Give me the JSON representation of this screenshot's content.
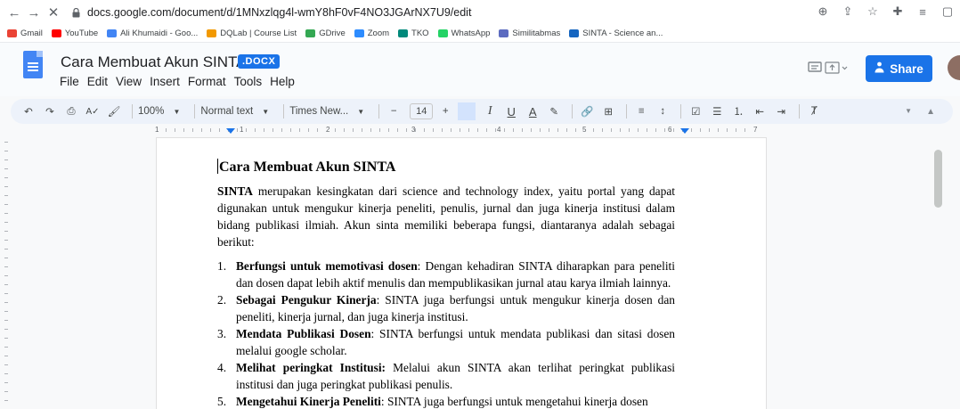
{
  "browser": {
    "url": "docs.google.com/document/d/1MNxzlqg4l-wmY8hF0vF4NO3JGArNX7U9/edit"
  },
  "bookmarks": [
    {
      "label": "Gmail",
      "color": "#ea4335"
    },
    {
      "label": "YouTube",
      "color": "#ff0000"
    },
    {
      "label": "Ali Khumaidi - Goo...",
      "color": "#4285f4"
    },
    {
      "label": "DQLab | Course List",
      "color": "#f29900"
    },
    {
      "label": "GDrive",
      "color": "#34a853"
    },
    {
      "label": "Zoom",
      "color": "#2d8cff"
    },
    {
      "label": "TKO",
      "color": "#00897b"
    },
    {
      "label": "WhatsApp",
      "color": "#25d366"
    },
    {
      "label": "Similitabmas",
      "color": "#5c6bc0"
    },
    {
      "label": "SINTA - Science an...",
      "color": "#1565c0"
    }
  ],
  "header": {
    "title": "Cara Membuat Akun SINTA",
    "badge": ".DOCX",
    "share_label": "Share"
  },
  "menu": [
    "File",
    "Edit",
    "View",
    "Insert",
    "Format",
    "Tools",
    "Help"
  ],
  "toolbar": {
    "zoom": "100%",
    "style": "Normal text",
    "font": "Times New...",
    "size": "14"
  },
  "ruler": [
    "1",
    "1",
    "2",
    "3",
    "4",
    "5",
    "6",
    "7"
  ],
  "document": {
    "heading": "Cara Membuat Akun SINTA",
    "intro_bold": "SINTA",
    "intro_rest": " merupakan kesingkatan dari science and technology index, yaitu portal yang dapat digunakan untuk mengukur kinerja peneliti, penulis, jurnal dan juga kinerja institusi dalam bidang publikasi ilmiah. Akun sinta memiliki beberapa fungsi, diantaranya adalah sebagai berikut:",
    "items": [
      {
        "num": "1.",
        "bold": "Berfungsi untuk memotivasi dosen",
        "rest": ": Dengan kehadiran SINTA diharapkan para peneliti dan dosen dapat lebih aktif menulis dan mempublikasikan jurnal atau karya ilmiah lainnya."
      },
      {
        "num": "2.",
        "bold": "Sebagai Pengukur Kinerja",
        "rest": ": SINTA juga berfungsi untuk mengukur kinerja dosen dan peneliti, kinerja jurnal, dan juga kinerja institusi."
      },
      {
        "num": "3.",
        "bold": "Mendata Publikasi Dosen",
        "rest": ": SINTA berfungsi untuk mendata publikasi dan sitasi dosen melalui google scholar."
      },
      {
        "num": "4.",
        "bold": "Melihat peringkat Institusi:",
        "rest": " Melalui akun SINTA akan terlihat peringkat publikasi institusi dan juga peringkat publikasi penulis."
      },
      {
        "num": "5.",
        "bold": "Mengetahui Kinerja Peneliti",
        "rest": ": SINTA juga berfungsi untuk mengetahui kinerja dosen"
      }
    ]
  }
}
